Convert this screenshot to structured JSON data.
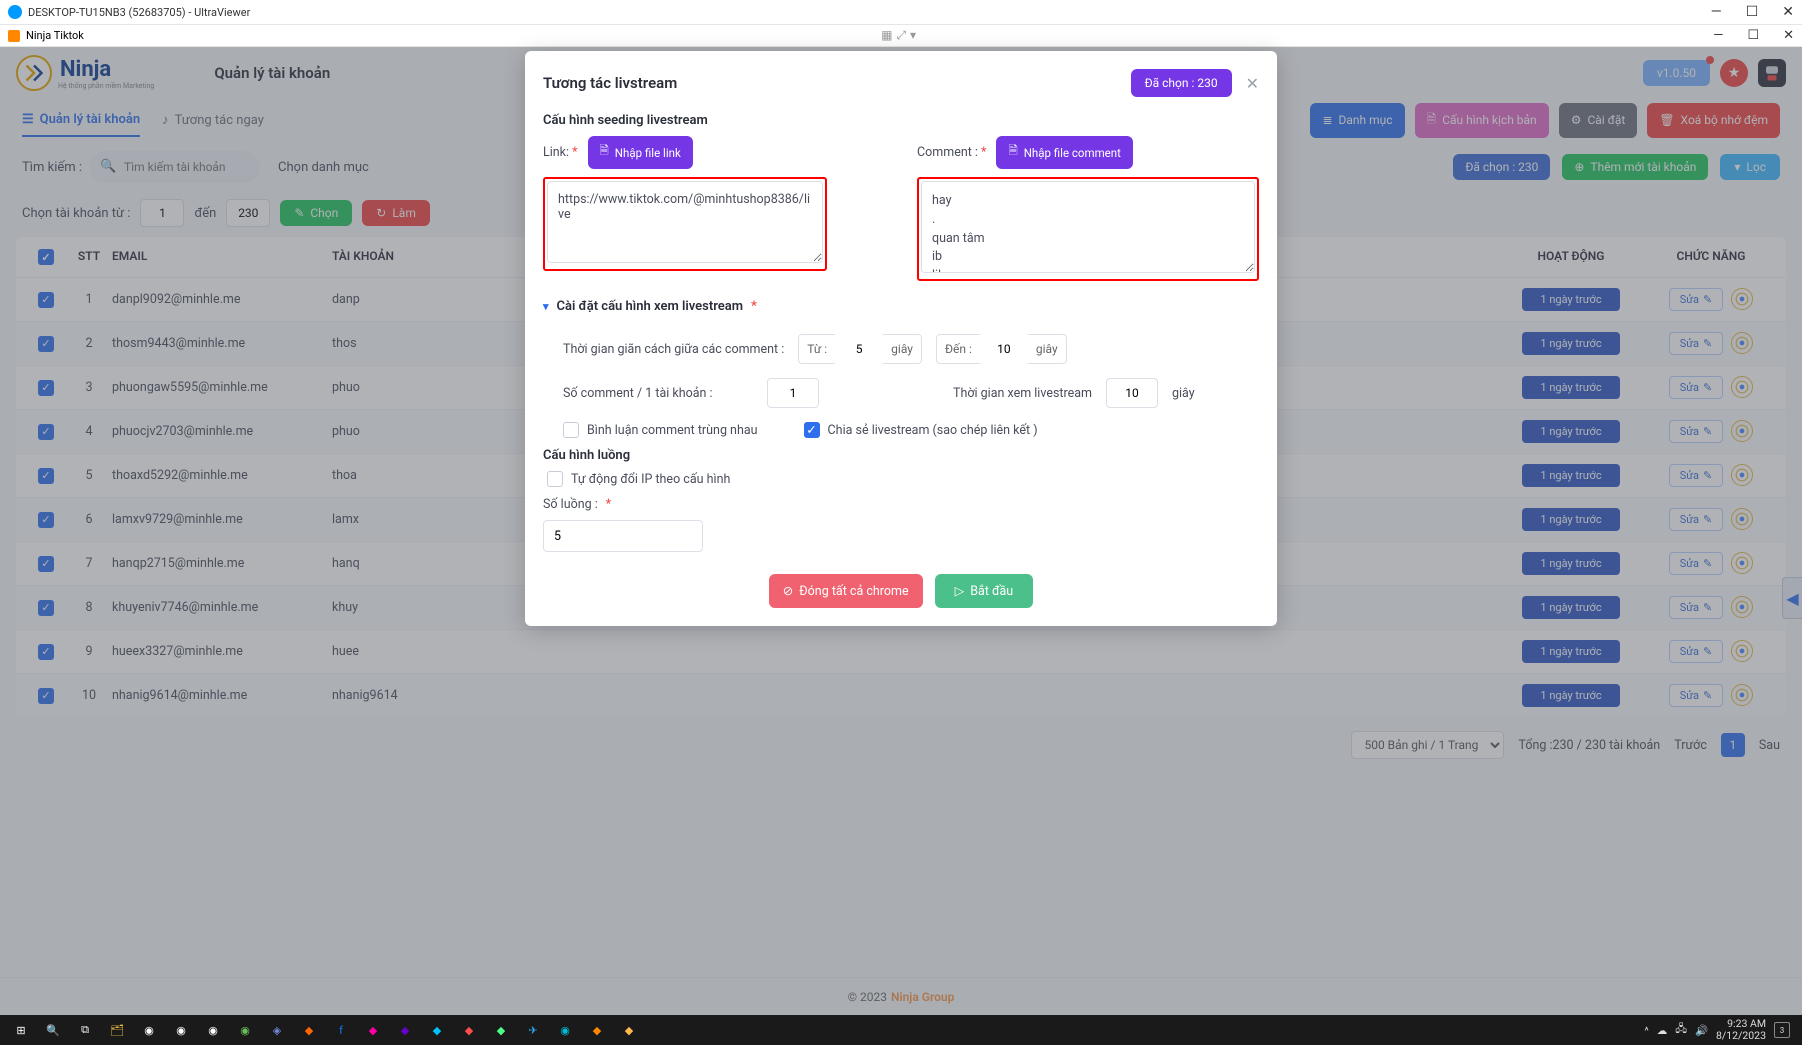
{
  "window": {
    "title": "DESKTOP-TU15NB3 (52683705) - UltraViewer",
    "app_title": "Ninja Tiktok"
  },
  "header": {
    "brand": "Ninja",
    "brand_sub": "Hệ thống phần mềm Marketing",
    "page_title": "Quản lý tài khoản",
    "version": "v1.0.50"
  },
  "tabs": {
    "manage": "Quản lý tài khoản",
    "interact": "Tương tác ngay",
    "danh_muc": "Danh mục",
    "cau_hinh_kich_ban": "Cấu hình kịch bản",
    "cai_dat": "Cài đặt",
    "xoa_cache": "Xoá bộ nhớ đệm"
  },
  "filters": {
    "search_label": "Tìm kiếm :",
    "search_placeholder": "Tìm kiếm tài khoản",
    "category_label": "Chọn danh mục",
    "selected_badge": "Đã chọn : 230",
    "add_account": "Thêm mới tài khoản",
    "filter_btn": "Lọc",
    "range_label": "Chọn tài khoản từ :",
    "range_from": "1",
    "range_to_label": "đến",
    "range_to": "230",
    "chon": "Chọn",
    "lam": "Làm"
  },
  "table": {
    "heads": {
      "stt": "STT",
      "email": "EMAIL",
      "taikhoan": "TÀI KHOẢN",
      "hoatdong": "HOẠT ĐỘNG",
      "chucnang": "CHỨC NĂNG"
    },
    "activity": "1 ngày trước",
    "edit": "Sửa",
    "rows": [
      {
        "stt": "1",
        "email": "danpl9092@minhle.me",
        "tk": "danp"
      },
      {
        "stt": "2",
        "email": "thosm9443@minhle.me",
        "tk": "thos"
      },
      {
        "stt": "3",
        "email": "phuongaw5595@minhle.me",
        "tk": "phuo"
      },
      {
        "stt": "4",
        "email": "phuocjv2703@minhle.me",
        "tk": "phuo"
      },
      {
        "stt": "5",
        "email": "thoaxd5292@minhle.me",
        "tk": "thoa"
      },
      {
        "stt": "6",
        "email": "lamxv9729@minhle.me",
        "tk": "lamx"
      },
      {
        "stt": "7",
        "email": "hanqp2715@minhle.me",
        "tk": "hanq"
      },
      {
        "stt": "8",
        "email": "khuyeniv7746@minhle.me",
        "tk": "khuy"
      },
      {
        "stt": "9",
        "email": "hueex3327@minhle.me",
        "tk": "huee"
      },
      {
        "stt": "10",
        "email": "nhanig9614@minhle.me",
        "tk": "nhanig9614"
      }
    ]
  },
  "pager": {
    "per_page": "500 Bản ghi / 1 Trang",
    "total": "Tổng :230 / 230 tài khoản",
    "prev": "Trước",
    "page": "1",
    "next": "Sau"
  },
  "footer": {
    "copy": "© 2023",
    "brand": "Ninja Group"
  },
  "modal": {
    "title": "Tương tác livstream",
    "selected": "Đã chọn : 230",
    "section": "Cấu hình seeding livestream",
    "link_label": "Link:",
    "link_btn": "Nhập file link",
    "link_value": "https://www.tiktok.com/@minhtushop8386/live",
    "comment_label": "Comment :",
    "comment_btn": "Nhập file comment",
    "comment_value": "hay\n.\nquan tâm\nib\nlike",
    "view_config_title": "Cài đặt cấu hình xem livestream",
    "delay_label": "Thời gian giãn cách giữa các comment :",
    "from_label": "Từ :",
    "from_val": "5",
    "unit": "giây",
    "to_label": "Đến :",
    "to_val": "10",
    "per_acc_label": "Số comment / 1 tài khoản :",
    "per_acc_val": "1",
    "watch_label": "Thời gian xem livestream",
    "watch_val": "10",
    "dup_comment": "Bình luận comment trùng nhau",
    "share_live": "Chia sẻ livestream (sao chép liên kết )",
    "thread_section": "Cấu hình luồng",
    "auto_ip": "Tự động đổi IP theo cấu hình",
    "thread_count_label": "Số luồng :",
    "thread_count_val": "5",
    "close_chrome": "Đóng tất cả chrome",
    "start": "Bắt đầu"
  },
  "tray": {
    "time": "9:23 AM",
    "date": "8/12/2023",
    "notif_count": "3"
  }
}
